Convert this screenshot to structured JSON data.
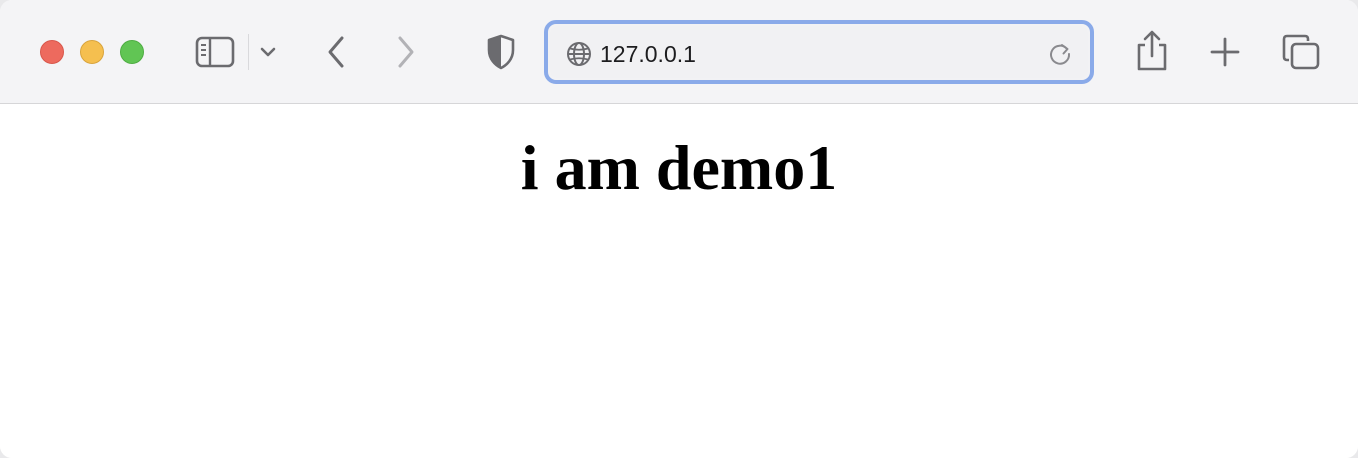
{
  "browser": {
    "address_bar": {
      "url": "127.0.0.1"
    },
    "colors": {
      "close": "#ed6a5e",
      "minimize": "#f5bf4f",
      "maximize": "#61c554",
      "focus_ring": "#8aaae9"
    },
    "icons": [
      "sidebar-icon",
      "chevron-down-icon",
      "back-arrow-icon",
      "forward-arrow-icon",
      "privacy-shield-icon",
      "globe-icon",
      "reload-icon",
      "share-icon",
      "plus-icon",
      "tabs-overview-icon"
    ]
  },
  "page": {
    "heading": "i am demo1"
  }
}
